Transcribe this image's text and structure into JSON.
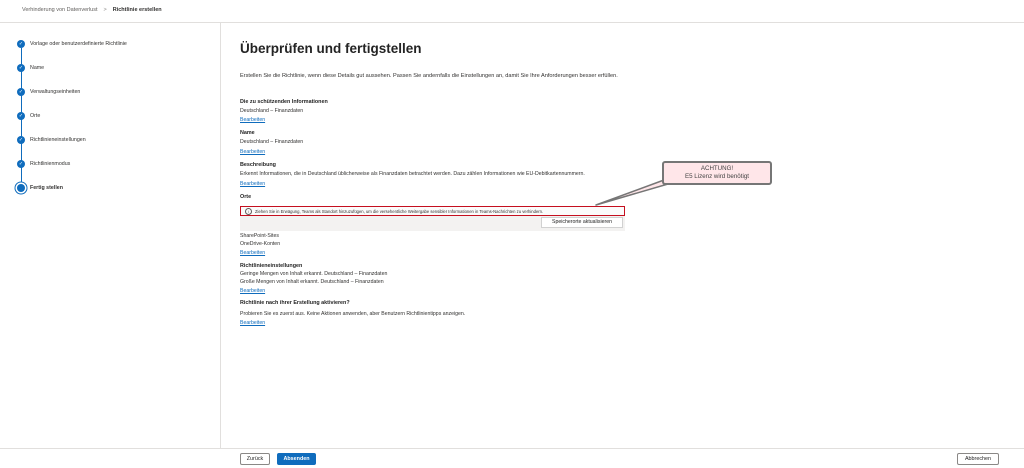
{
  "breadcrumb": {
    "parent": "Verhinderung von Datenverlust",
    "separator": ">",
    "current": "Richtlinie erstellen"
  },
  "steps": [
    {
      "label": "Vorlage oder benutzerdefinierte Richtlinie",
      "status": "done"
    },
    {
      "label": "Name",
      "status": "done"
    },
    {
      "label": "Verwaltungseinheiten",
      "status": "done"
    },
    {
      "label": "Orte",
      "status": "done"
    },
    {
      "label": "Richtlinieneinstellungen",
      "status": "done"
    },
    {
      "label": "Richtlinienmodus",
      "status": "done"
    },
    {
      "label": "Fertig stellen",
      "status": "current"
    }
  ],
  "main": {
    "title": "Überprüfen und fertigstellen",
    "intro": "Erstellen Sie die Richtlinie, wenn diese Details gut aussehen. Passen Sie andernfalls die Einstellungen an, damit Sie Ihre Anforderungen besser erfüllen.",
    "edit_label": "Bearbeiten",
    "info": {
      "heading": "Die zu schützenden Informationen",
      "value": "Deutschland – Finanzdaten"
    },
    "name": {
      "heading": "Name",
      "value": "Deutschland – Finanzdaten"
    },
    "description": {
      "heading": "Beschreibung",
      "value": "Erkennt Informationen, die in Deutschland üblicherweise als Finanzdaten betrachtet werden. Dazu zählen Informationen wie EU-Debitkartennummern."
    },
    "locations": {
      "heading": "Orte",
      "message": "Ziehen Sie in Erwägung, Teams als Standort hinzuzufügen, um die versehentliche Weitergabe sensibler Informationen in Teams-Nachrichten zu verhindern.",
      "update_button": "Speicherorte aktualisieren",
      "items": [
        "SharePoint-Sites",
        "OneDrive-Konten"
      ]
    },
    "settings": {
      "heading": "Richtlinieneinstellungen",
      "lines": [
        "Geringe Mengen von Inhalt erkannt. Deutschland – Finanzdaten",
        "Große Mengen von Inhalt erkannt. Deutschland – Finanzdaten"
      ]
    },
    "activate": {
      "heading": "Richtlinie nach ihrer Erstellung aktivieren?",
      "value": "Probieren Sie es zuerst aus. Keine Aktionen anwenden, aber Benutzern Richtlinientipps anzeigen."
    }
  },
  "callout": {
    "line1": "ACHTUNG!",
    "line2": "E5 Lizenz wird benötigt"
  },
  "footer": {
    "back": "Zurück",
    "submit": "Absenden",
    "cancel": "Abbrechen"
  },
  "colors": {
    "accent": "#0f6cbd",
    "warning_border": "#c50f1f",
    "callout_fill": "#ffe6e9"
  }
}
